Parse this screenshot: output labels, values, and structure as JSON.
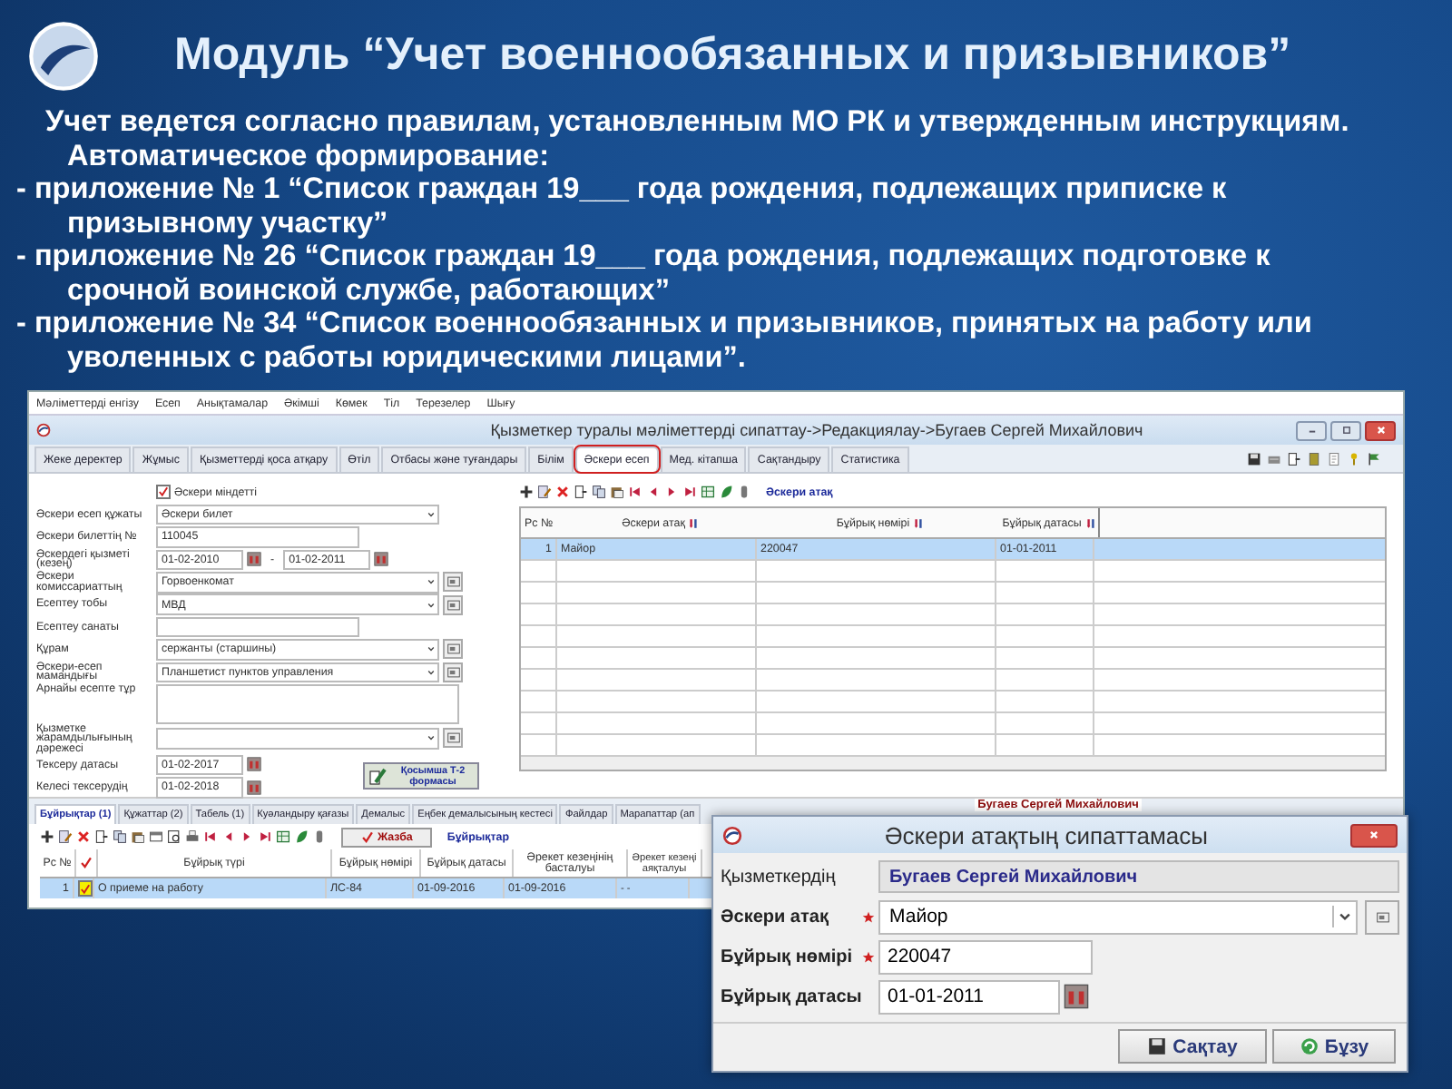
{
  "slide": {
    "title": "Модуль “Учет военнообязанных и призывников”",
    "paragraphs": [
      {
        "text": "Учет ведется согласно правилам, установленным МО РК и утвержденным инструкциям. Автоматическое формирование:"
      },
      {
        "text": "- приложение № 1 “Список граждан 19___ года рождения, подлежащих приписке к призывному участку”"
      },
      {
        "text": "- приложение № 26 “Список граждан 19___ года рождения, подлежащих подготовке к срочной воинской службе, работающих”"
      },
      {
        "text": "- приложение № 34  “Список военнообязанных и призывников, принятых на работу или уволенных с работы юридическими лицами”."
      }
    ]
  },
  "main_window": {
    "menu": [
      "Мәліметтерді енгізу",
      "Есеп",
      "Анықтамалар",
      "Әкімші",
      "Көмек",
      "Тіл",
      "Терезелер",
      "Шығу"
    ],
    "title": "Қызметкер туралы мәліметтерді сипаттау->Редакциялау->Бугаев Сергей Михайлович",
    "tabs": [
      {
        "label": "Жеке деректер",
        "selected": false
      },
      {
        "label": "Жұмыс",
        "selected": false
      },
      {
        "label": "Қызметтерді қоса атқару",
        "selected": false
      },
      {
        "label": "Өтіл",
        "selected": false
      },
      {
        "label": "Отбасы және туғандары",
        "selected": false
      },
      {
        "label": "Білім",
        "selected": false
      },
      {
        "label": "Әскери есеп",
        "selected": true
      },
      {
        "label": "Мед. кітапша",
        "selected": false
      },
      {
        "label": "Сақтандыру",
        "selected": false
      },
      {
        "label": "Статистика",
        "selected": false
      }
    ],
    "form": {
      "fields": [
        {
          "kind": "checkbox",
          "label": "Әскери міндетті",
          "checked": true
        },
        {
          "kind": "select",
          "label": "Әскери есеп құжаты",
          "value": "Әскери билет",
          "lookup": false
        },
        {
          "kind": "input",
          "label": "Әскери билеттің №",
          "value": "110045"
        },
        {
          "kind": "range",
          "label": "Әскердегі қызметі (кезең)",
          "from": "01-02-2010",
          "separator": "-",
          "to": "01-02-2011"
        },
        {
          "kind": "select",
          "label": "Әскери комиссариаттың",
          "value": "Горвоенкомат",
          "lookup": true
        },
        {
          "kind": "select",
          "label": "Есептеу тобы",
          "value": "МВД",
          "lookup": true
        },
        {
          "kind": "input",
          "label": "Есептеу санаты"
        },
        {
          "kind": "select",
          "label": "Құрам",
          "value": "сержанты (старшины)",
          "lookup": true
        },
        {
          "kind": "select",
          "label": "Әскери-есеп мамандығы",
          "value": "Планшетист пунктов управления",
          "lookup": true
        },
        {
          "kind": "textarea",
          "label": "Арнайы есепте тұр"
        },
        {
          "kind": "select",
          "label": "Қызметке жарамдылығының дәрежесі",
          "lookup": true
        }
      ],
      "inspection": {
        "fields": [
          {
            "label": "Тексеру датасы",
            "value": "01-02-2017"
          },
          {
            "label": "Келесі тексерудің",
            "value": "01-02-2018"
          }
        ],
        "button": "Қосымша Т-2 формасы"
      }
    },
    "rank_panel": {
      "caption": "Әскери атақ",
      "columns": [
        "Рс №",
        "Әскери атақ",
        "Бұйрық нөмірі",
        "Бұйрық датасы"
      ],
      "rows": [
        {
          "cells": [
            "1",
            "Майор",
            "220047",
            "01-01-2011"
          ],
          "selected": true
        }
      ]
    },
    "bottom_tabs": [
      {
        "label": "Бұйрықтар (1)",
        "selected": true
      },
      {
        "label": "Құжаттар (2)",
        "selected": false
      },
      {
        "label": "Табель (1)",
        "selected": false
      },
      {
        "label": "Куәландыру қағазы",
        "selected": false
      },
      {
        "label": "Демалыс",
        "selected": false
      },
      {
        "label": "Еңбек демалысының кестесі",
        "selected": false
      },
      {
        "label": "Файлдар",
        "selected": false
      },
      {
        "label": "Марапаттар (ап",
        "selected": false
      }
    ],
    "employee_name": "Бугаев Сергей Михайлович",
    "orders": {
      "button": "Жазба",
      "caption": "Бұйрықтар",
      "columns": [
        "Рс №",
        "Бұйрық түрі",
        "Бұйрық нөмірі",
        "Бұйрық датасы",
        "Әрекет кезеңінің басталуы",
        "Әрекет кезеңі аяқталуы"
      ],
      "rows": [
        {
          "checked": true,
          "cells": [
            "1",
            "О приеме на работу",
            "ЛС-84",
            "01-09-2016",
            "01-09-2016",
            "- -"
          ],
          "selected": true
        }
      ]
    }
  },
  "dialog": {
    "title": "Әскери атақтың сипаттамасы",
    "fields": [
      {
        "kind": "readonly",
        "label": "Қызметкердің",
        "value": "Бугаев Сергей Михайлович",
        "required": false
      },
      {
        "kind": "select",
        "label": "Әскери атақ",
        "value": "Майор",
        "required": true
      },
      {
        "kind": "input",
        "label": "Бұйрық нөмірі",
        "value": "220047",
        "required": true
      },
      {
        "kind": "date",
        "label": "Бұйрық датасы",
        "value": "01-01-2011",
        "required": false
      }
    ],
    "buttons": [
      {
        "kind": "save",
        "label": "Сақтау"
      },
      {
        "kind": "cancel",
        "label": "Бұзу"
      }
    ]
  }
}
